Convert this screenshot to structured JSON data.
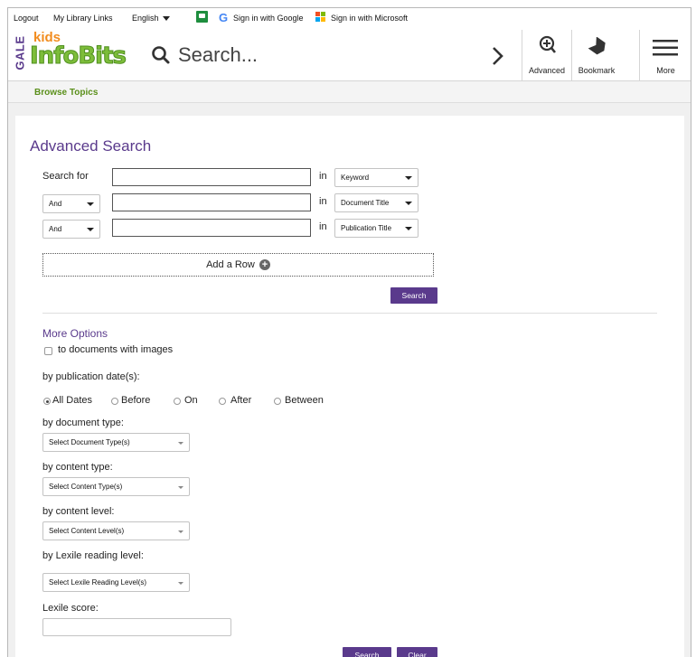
{
  "topbar": {
    "logout": "Logout",
    "library_links": "My Library Links",
    "language": "English",
    "google_signin": "Sign in with Google",
    "microsoft_signin": "Sign in with Microsoft"
  },
  "header": {
    "brand_vertical": "GALE",
    "brand_kids": "kids",
    "brand_name": "InfoBits",
    "search_placeholder": "Search...",
    "advanced_label": "Advanced",
    "bookmark_label": "Bookmark",
    "more_label": "More"
  },
  "nav": {
    "browse_topics": "Browse Topics"
  },
  "advanced": {
    "title": "Advanced Search",
    "search_for_label": "Search for",
    "in_label": "in",
    "rows": [
      {
        "operator": "",
        "field": "Keyword"
      },
      {
        "operator": "And",
        "field": "Document Title"
      },
      {
        "operator": "And",
        "field": "Publication Title"
      }
    ],
    "add_row": "Add a Row",
    "search_button": "Search"
  },
  "more_options": {
    "title": "More Options",
    "images_checkbox": "to documents with images",
    "pub_date_label": "by publication date(s):",
    "date_options": [
      "All Dates",
      "Before",
      "On",
      "After",
      "Between"
    ],
    "doc_type_label": "by document type:",
    "doc_type_select": "Select Document Type(s)",
    "content_type_label": "by content type:",
    "content_type_select": "Select Content Type(s)",
    "content_level_label": "by content level:",
    "content_level_select": "Select Content Level(s)",
    "lexile_level_label": "by Lexile reading level:",
    "lexile_level_select": "Select Lexile Reading Level(s)",
    "lexile_score_label": "Lexile score:"
  },
  "footer_buttons": {
    "search": "Search",
    "clear": "Clear"
  },
  "colors": {
    "accent": "#5a3a8c",
    "brand_green": "#7dbd3a",
    "brand_orange": "#f28c1e"
  }
}
